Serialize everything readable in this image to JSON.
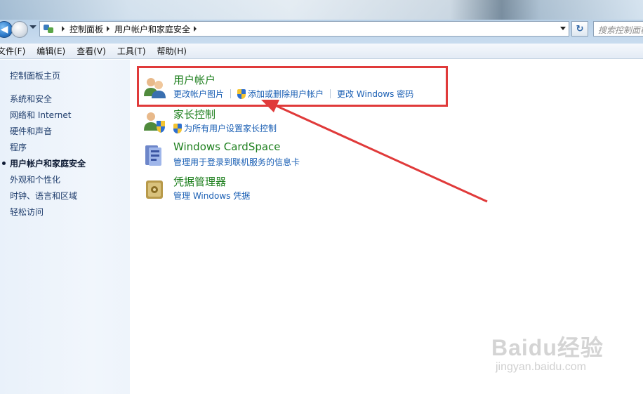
{
  "address": {
    "crumbs": [
      "控制面板",
      "用户帐户和家庭安全"
    ]
  },
  "search": {
    "placeholder": "搜索控制面板"
  },
  "menu": [
    "文件(F)",
    "编辑(E)",
    "查看(V)",
    "工具(T)",
    "帮助(H)"
  ],
  "sidebar": {
    "home": "控制面板主页",
    "items": [
      "系统和安全",
      "网络和 Internet",
      "硬件和声音",
      "程序",
      "用户帐户和家庭安全",
      "外观和个性化",
      "时钟、语言和区域",
      "轻松访问"
    ],
    "current_index": 4
  },
  "categories": [
    {
      "title": "用户帐户",
      "icon": "users-icon",
      "links": [
        "更改帐户图片",
        "添加或删除用户帐户",
        "更改 Windows 密码"
      ]
    },
    {
      "title": "家长控制",
      "icon": "parental-control-icon",
      "links": [
        "为所有用户设置家长控制"
      ]
    },
    {
      "title": "Windows CardSpace",
      "icon": "cardspace-icon",
      "links": [
        "管理用于登录到联机服务的信息卡"
      ]
    },
    {
      "title": "凭据管理器",
      "icon": "credential-vault-icon",
      "links": [
        "管理 Windows 凭据"
      ]
    }
  ],
  "watermark": {
    "brand": "Baidu经验",
    "sub": "jingyan.baidu.com"
  },
  "colors": {
    "highlight": "#e03a3a",
    "category_title": "#1d7f1d",
    "link": "#1a5fb4"
  }
}
